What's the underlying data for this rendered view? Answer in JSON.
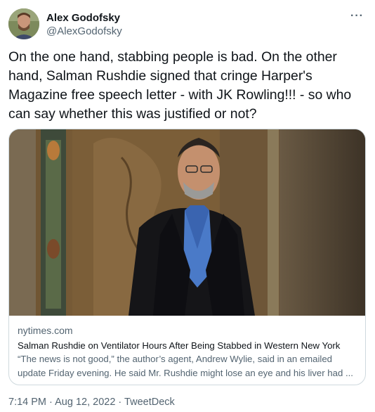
{
  "author": {
    "name": "Alex Godofsky",
    "handle": "@AlexGodofsky"
  },
  "tweet": {
    "text": "On the one hand, stabbing people is bad. On the other hand, Salman Rushdie signed that cringe Harper's Magazine free speech letter - with JK Rowling!!! - so who can say whether this was justified or not?"
  },
  "link_card": {
    "domain": "nytimes.com",
    "title": "Salman Rushdie on Ventilator Hours After Being Stabbed in Western New York",
    "description": "“The news is not good,” the author’s agent, Andrew Wylie, said in an emailed update Friday evening. He said Mr. Rushdie might lose an eye and his liver had ..."
  },
  "meta": {
    "time": "7:14 PM",
    "separator": "·",
    "date": "Aug 12, 2022",
    "source": "TweetDeck"
  },
  "icons": {
    "more": "more-horizontal-icon",
    "avatar": "profile-photo"
  },
  "colors": {
    "text_primary": "#0f1419",
    "text_secondary": "#536471",
    "border": "#cfd9de"
  }
}
